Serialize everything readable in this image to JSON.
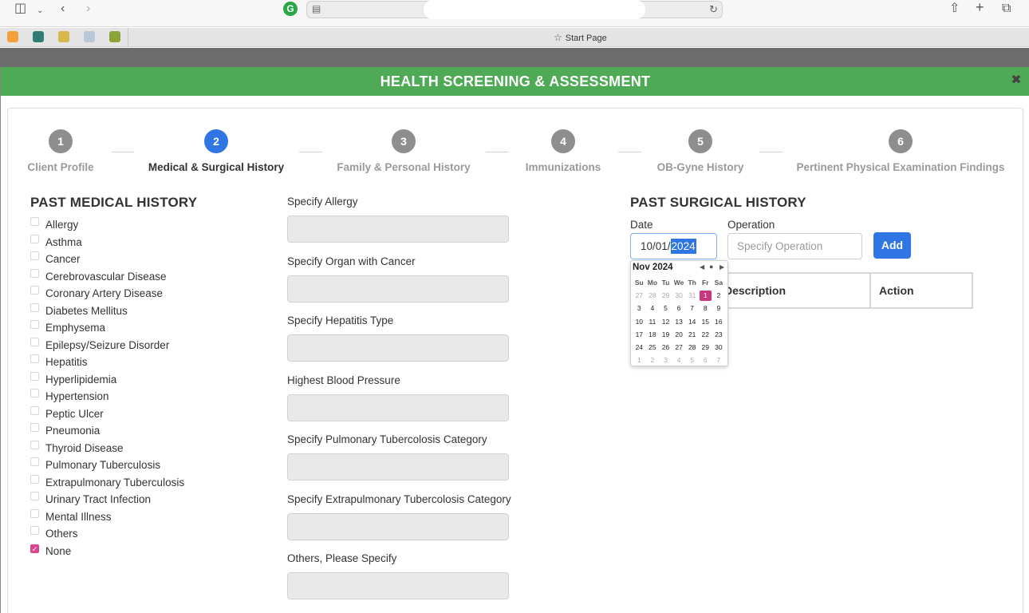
{
  "browser": {
    "tab_title": "Start Page",
    "address_icon": "reader-icon",
    "sidebar_icon": "sidebar-toggle-icon"
  },
  "modal": {
    "title": "HEALTH SCREENING & ASSESSMENT",
    "close_icon": "close-icon",
    "header_color": "#4eaa55"
  },
  "stepper": {
    "steps": [
      {
        "number": "1",
        "label": "Client Profile",
        "active": false
      },
      {
        "number": "2",
        "label": "Medical & Surgical History",
        "active": true
      },
      {
        "number": "3",
        "label": "Family & Personal History",
        "active": false
      },
      {
        "number": "4",
        "label": "Immunizations",
        "active": false
      },
      {
        "number": "5",
        "label": "OB-Gyne History",
        "active": false
      },
      {
        "number": "6",
        "label": "Pertinent Physical Examination Findings",
        "active": false
      }
    ],
    "active_color": "#2f76e4"
  },
  "past_medical_history": {
    "title": "PAST MEDICAL HISTORY",
    "items": [
      {
        "label": "Allergy",
        "checked": false
      },
      {
        "label": "Asthma",
        "checked": false
      },
      {
        "label": "Cancer",
        "checked": false
      },
      {
        "label": "Cerebrovascular Disease",
        "checked": false
      },
      {
        "label": "Coronary Artery Disease",
        "checked": false
      },
      {
        "label": "Diabetes Mellitus",
        "checked": false
      },
      {
        "label": "Emphysema",
        "checked": false
      },
      {
        "label": "Epilepsy/Seizure Disorder",
        "checked": false
      },
      {
        "label": "Hepatitis",
        "checked": false
      },
      {
        "label": "Hyperlipidemia",
        "checked": false
      },
      {
        "label": "Hypertension",
        "checked": false
      },
      {
        "label": "Peptic Ulcer",
        "checked": false
      },
      {
        "label": "Pneumonia",
        "checked": false
      },
      {
        "label": "Thyroid Disease",
        "checked": false
      },
      {
        "label": "Pulmonary Tuberculosis",
        "checked": false
      },
      {
        "label": "Extrapulmonary Tuberculosis",
        "checked": false
      },
      {
        "label": "Urinary Tract Infection",
        "checked": false
      },
      {
        "label": "Mental Illness",
        "checked": false
      },
      {
        "label": "Others",
        "checked": false
      },
      {
        "label": "None",
        "checked": true
      }
    ],
    "specify_fields": [
      {
        "label": "Specify Allergy",
        "value": ""
      },
      {
        "label": "Specify Organ with Cancer",
        "value": ""
      },
      {
        "label": "Specify Hepatitis Type",
        "value": ""
      },
      {
        "label": "Highest Blood Pressure",
        "value": ""
      },
      {
        "label": "Specify Pulmonary Tubercolosis Category",
        "value": ""
      },
      {
        "label": "Specify Extrapulmonary Tubercolosis Category",
        "value": ""
      },
      {
        "label": "Others, Please Specify",
        "value": ""
      }
    ]
  },
  "past_surgical_history": {
    "title": "PAST SURGICAL HISTORY",
    "date_label": "Date",
    "date_value_prefix": "10/01/",
    "date_value_selected": "2024",
    "operation_label": "Operation",
    "operation_placeholder": "Specify Operation",
    "add_button": "Add",
    "table_headers": [
      "Description",
      "Action"
    ]
  },
  "datepicker": {
    "month_label": "Nov 2024",
    "weekdays": [
      "Su",
      "Mo",
      "Tu",
      "We",
      "Th",
      "Fr",
      "Sa"
    ],
    "weeks": [
      [
        {
          "d": "27",
          "m": true
        },
        {
          "d": "28",
          "m": true
        },
        {
          "d": "29",
          "m": true
        },
        {
          "d": "30",
          "m": true
        },
        {
          "d": "31",
          "m": true
        },
        {
          "d": "1",
          "sel": true
        },
        {
          "d": "2"
        }
      ],
      [
        {
          "d": "3"
        },
        {
          "d": "4"
        },
        {
          "d": "5"
        },
        {
          "d": "6"
        },
        {
          "d": "7"
        },
        {
          "d": "8"
        },
        {
          "d": "9"
        }
      ],
      [
        {
          "d": "10"
        },
        {
          "d": "11"
        },
        {
          "d": "12"
        },
        {
          "d": "13"
        },
        {
          "d": "14"
        },
        {
          "d": "15"
        },
        {
          "d": "16"
        }
      ],
      [
        {
          "d": "17"
        },
        {
          "d": "18"
        },
        {
          "d": "19"
        },
        {
          "d": "20"
        },
        {
          "d": "21"
        },
        {
          "d": "22"
        },
        {
          "d": "23"
        }
      ],
      [
        {
          "d": "24"
        },
        {
          "d": "25"
        },
        {
          "d": "26"
        },
        {
          "d": "27"
        },
        {
          "d": "28"
        },
        {
          "d": "29"
        },
        {
          "d": "30"
        }
      ],
      [
        {
          "d": "1",
          "m": true
        },
        {
          "d": "2",
          "m": true
        },
        {
          "d": "3",
          "m": true
        },
        {
          "d": "4",
          "m": true
        },
        {
          "d": "5",
          "m": true
        },
        {
          "d": "6",
          "m": true
        },
        {
          "d": "7",
          "m": true
        }
      ]
    ],
    "selected_color": "#c8367f"
  }
}
